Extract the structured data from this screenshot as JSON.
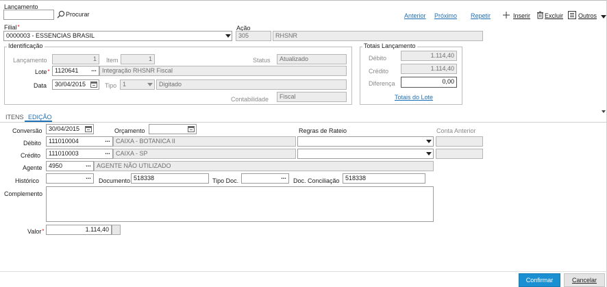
{
  "header": {
    "title": "Lançamento",
    "search_button": "Procurar",
    "search_value": ""
  },
  "toolbar": {
    "anterior": "Anterior",
    "proximo": "Próximo",
    "repetir": "Repetir",
    "inserir": "Inserir",
    "excluir": "Excluir",
    "outros": "Outros"
  },
  "filial": {
    "label": "Filial",
    "value": "0000003 - ESSENCIAS BRASIL"
  },
  "acao": {
    "label": "Ação",
    "code": "305",
    "name": "RHSNR"
  },
  "identificacao": {
    "legend": "Identificação",
    "lancamento_label": "Lançamento",
    "lancamento_value": "1",
    "item_label": "Item",
    "item_value": "1",
    "status_label": "Status",
    "status_value": "Atualizado",
    "lote_label": "Lote",
    "lote_value": "1120641",
    "lote_desc": "Integração RHSNR Fiscal",
    "data_label": "Data",
    "data_value": "30/04/2015",
    "tipo_label": "Tipo",
    "tipo_value": "1",
    "tipo_desc": "Digitado",
    "contabilidade_label": "Contabilidade",
    "contabilidade_value": "Fiscal"
  },
  "totais": {
    "legend": "Totais Lançamento",
    "debito_label": "Débito",
    "debito_value": "1.114,40",
    "credito_label": "Crédito",
    "credito_value": "1.114,40",
    "diferenca_label": "Diferença",
    "diferenca_value": "0,00",
    "totais_lote_link": "Totais do Lote"
  },
  "tabs": [
    {
      "label": "ITENS",
      "active": false
    },
    {
      "label": "EDIÇÃO",
      "active": true
    }
  ],
  "edicao": {
    "conversao_label": "Conversão",
    "conversao_value": "30/04/2015",
    "orcamento_label": "Orçamento",
    "orcamento_value": "",
    "regras_label": "Regras de Rateio",
    "conta_anterior_label": "Conta Anterior",
    "debito_label": "Débito",
    "debito_code": "111010004",
    "debito_desc": "CAIXA - BOTANICA II",
    "credito_label": "Crédito",
    "credito_code": "111010003",
    "credito_desc": "CAIXA - SP",
    "agente_label": "Agente",
    "agente_code": "4950",
    "agente_desc": "AGENTE NÃO UTILIZADO",
    "historico_label": "Histórico",
    "historico_value": "",
    "documento_label": "Documento",
    "documento_value": "518338",
    "tipo_doc_label": "Tipo Doc.",
    "tipo_doc_value": "",
    "doc_conciliacao_label": "Doc. Conciliação",
    "doc_conciliacao_value": "518338",
    "complemento_label": "Complemento",
    "complemento_value": "",
    "valor_label": "Valor",
    "valor_value": "1.114,40"
  },
  "footer": {
    "confirmar": "Confirmar",
    "cancelar": "Cancelar"
  },
  "colors": {
    "link": "#1f6fb5",
    "primary_button": "#1a8fd1",
    "required_marker": "#dd1111"
  }
}
